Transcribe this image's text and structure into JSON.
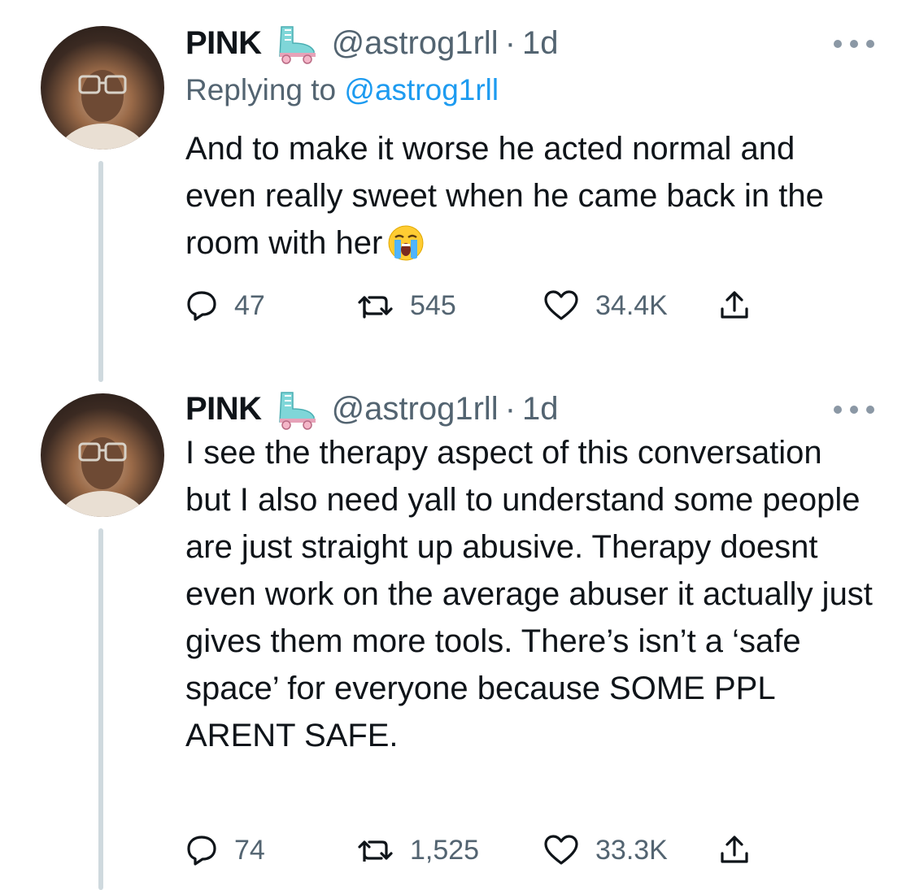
{
  "tweets": [
    {
      "name": "PINK",
      "handle": "@astrog1rll",
      "separator": "·",
      "time": "1d",
      "replying_prefix": "Replying to ",
      "replying_to": "@astrog1rll",
      "text": "And to make it worse he acted normal and even really sweet when he came back in the room with her",
      "emoji": "loudly-crying-face",
      "replies": "47",
      "retweets": "545",
      "likes": "34.4K"
    },
    {
      "name": "PINK",
      "handle": "@astrog1rll",
      "separator": "·",
      "time": "1d",
      "text": "I see the therapy aspect of this conversation but I also need yall to understand some people are just straight up abusive. Therapy doesnt even work on the average abuser it actually just gives them more tools. There’s isn’t a ‘safe space’ for everyone because SOME PPL ARENT SAFE.",
      "replies": "74",
      "retweets": "1,525",
      "likes": "33.3K"
    }
  ],
  "icons": {
    "badge": "roller-skate-icon",
    "more": "more-options-icon",
    "reply": "reply-icon",
    "retweet": "retweet-icon",
    "like": "heart-icon",
    "share": "share-icon"
  },
  "colors": {
    "text": "#0f1419",
    "secondary": "#536471",
    "link": "#1d9bf0",
    "thread_line": "#cfd9de"
  }
}
